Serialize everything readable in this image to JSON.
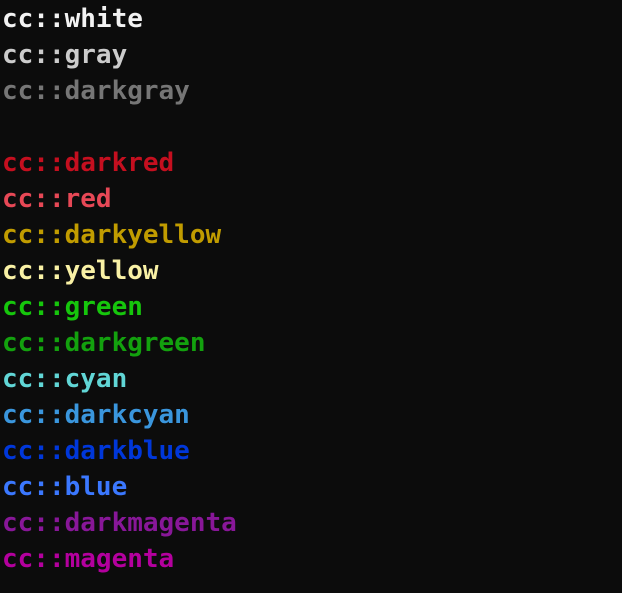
{
  "terminal": {
    "background": "#0c0c0c",
    "lines": [
      {
        "text": "cc::white",
        "color": "#f2f2f2"
      },
      {
        "text": "cc::gray",
        "color": "#cccccc"
      },
      {
        "text": "cc::darkgray",
        "color": "#767676"
      },
      {
        "text": "",
        "color": "#cccccc"
      },
      {
        "text": "cc::darkred",
        "color": "#c50f1f"
      },
      {
        "text": "cc::red",
        "color": "#e74856"
      },
      {
        "text": "cc::darkyellow",
        "color": "#c19c00"
      },
      {
        "text": "cc::yellow",
        "color": "#f9f1a5"
      },
      {
        "text": "cc::green",
        "color": "#16c60c"
      },
      {
        "text": "cc::darkgreen",
        "color": "#13a10e"
      },
      {
        "text": "cc::cyan",
        "color": "#61d6d6"
      },
      {
        "text": "cc::darkcyan",
        "color": "#3a96dd"
      },
      {
        "text": "cc::darkblue",
        "color": "#0037da"
      },
      {
        "text": "cc::blue",
        "color": "#3b78ff"
      },
      {
        "text": "cc::darkmagenta",
        "color": "#881798"
      },
      {
        "text": "cc::magenta",
        "color": "#b4009e"
      }
    ]
  }
}
